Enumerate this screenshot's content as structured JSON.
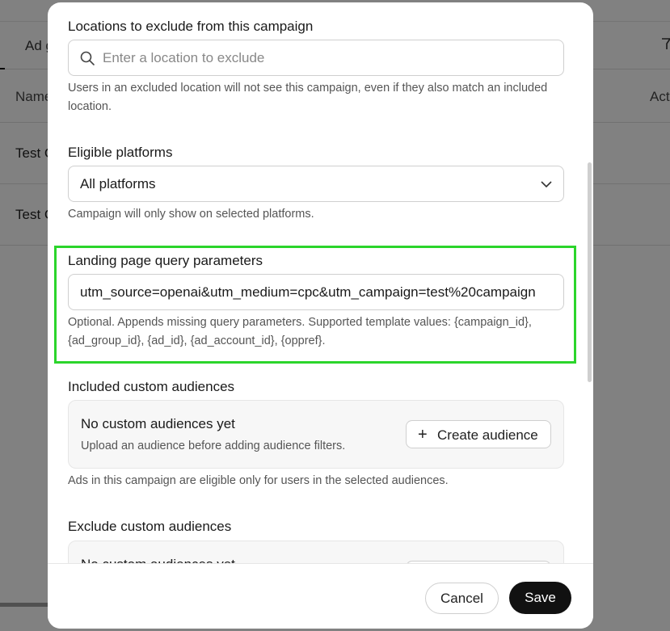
{
  "background": {
    "tab_label": "Ad g",
    "col_name": "Name",
    "col_actions": "Act",
    "rows": [
      "Test C",
      "Test C"
    ]
  },
  "modal": {
    "exclude_locations": {
      "label": "Locations to exclude from this campaign",
      "placeholder": "Enter a location to exclude",
      "help": "Users in an excluded location will not see this campaign, even if they also match an included location."
    },
    "platforms": {
      "label": "Eligible platforms",
      "value": "All platforms",
      "help": "Campaign will only show on selected platforms."
    },
    "query_params": {
      "label": "Landing page query parameters",
      "value": "utm_source=openai&utm_medium=cpc&utm_campaign=test%20campaign",
      "help": "Optional. Appends missing query parameters. Supported template values: {campaign_id}, {ad_group_id}, {ad_id}, {ad_account_id}, {oppref}."
    },
    "included_audiences": {
      "label": "Included custom audiences",
      "empty_title": "No custom audiences yet",
      "empty_sub": "Upload an audience before adding audience filters.",
      "create_label": "Create audience",
      "help": "Ads in this campaign are eligible only for users in the selected audiences."
    },
    "excluded_audiences": {
      "label": "Exclude custom audiences",
      "empty_title": "No custom audiences yet"
    },
    "footer": {
      "cancel_label": "Cancel",
      "save_label": "Save"
    }
  },
  "colors": {
    "highlight": "#2bd52b",
    "primary_button": "#111111"
  }
}
